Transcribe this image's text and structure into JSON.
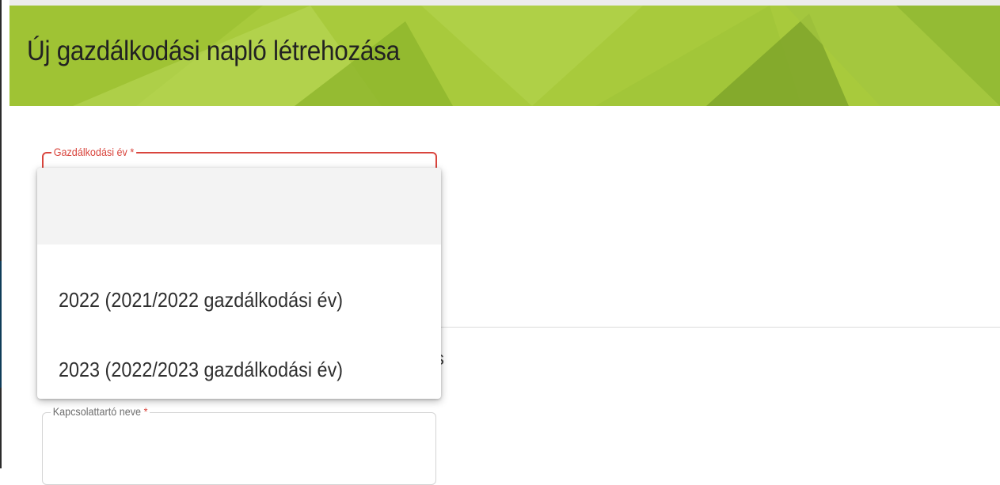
{
  "header": {
    "title": "Új gazdálkodási napló létrehozása",
    "color": "#a8ca3c"
  },
  "form": {
    "year_field": {
      "label": "Gazdálkodási év",
      "required_mark": "*",
      "state": "error",
      "error_color": "#d9453d"
    },
    "contact_field": {
      "label": "Kapcsolattartó neve",
      "required_mark": "*",
      "value": ""
    },
    "partial_label": "s"
  },
  "dropdown": {
    "options": [
      {
        "label": ""
      },
      {
        "label": "2022 (2021/2022 gazdálkodási év)"
      },
      {
        "label": "2023 (2022/2023 gazdálkodási év)"
      }
    ]
  }
}
